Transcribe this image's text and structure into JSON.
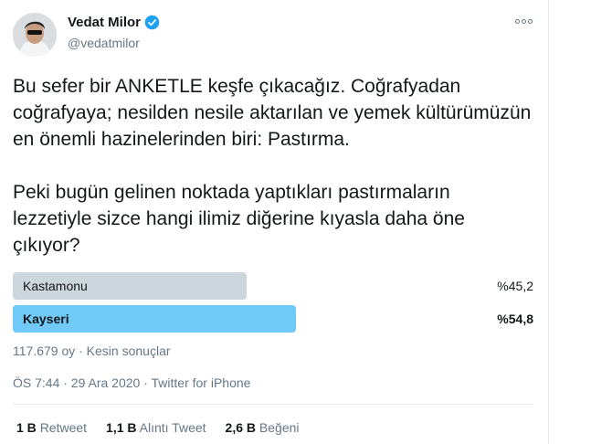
{
  "user": {
    "display_name": "Vedat Milor",
    "handle": "@vedatmilor",
    "verified": true
  },
  "tweet": {
    "paragraphs": [
      "Bu sefer bir ANKETLE keşfe çıkacağız. Coğrafyadan coğrafyaya; nesilden nesile aktarılan ve yemek kültürümüzün en önemli hazinelerinden biri: Pastırma.",
      "Peki bugün gelinen noktada yaptıkları pastırmaların lezzetiyle sizce hangi ilimiz diğerine kıyasla daha öne çıkıyor?"
    ]
  },
  "poll": {
    "options": [
      {
        "label": "Kastamonu",
        "percent_text": "%45,2",
        "share": 0.452,
        "winner": false
      },
      {
        "label": "Kayseri",
        "percent_text": "%54,8",
        "share": 0.548,
        "winner": true
      }
    ],
    "meta": "117.679 oy · Kesin sonuçlar"
  },
  "timestamp": "ÖS 7:44 · 29 Ara 2020 · Twitter for iPhone",
  "stats": [
    {
      "count": "1 B",
      "label": "Retweet"
    },
    {
      "count": "1,1 B",
      "label": "Alıntı Tweet"
    },
    {
      "count": "2,6 B",
      "label": "Beğeni"
    }
  ],
  "colors": {
    "winner_bar": "#71c9f8",
    "loser_bar": "#ccd6dd",
    "verified": "#1da1f2",
    "secondary_text": "#657786"
  }
}
